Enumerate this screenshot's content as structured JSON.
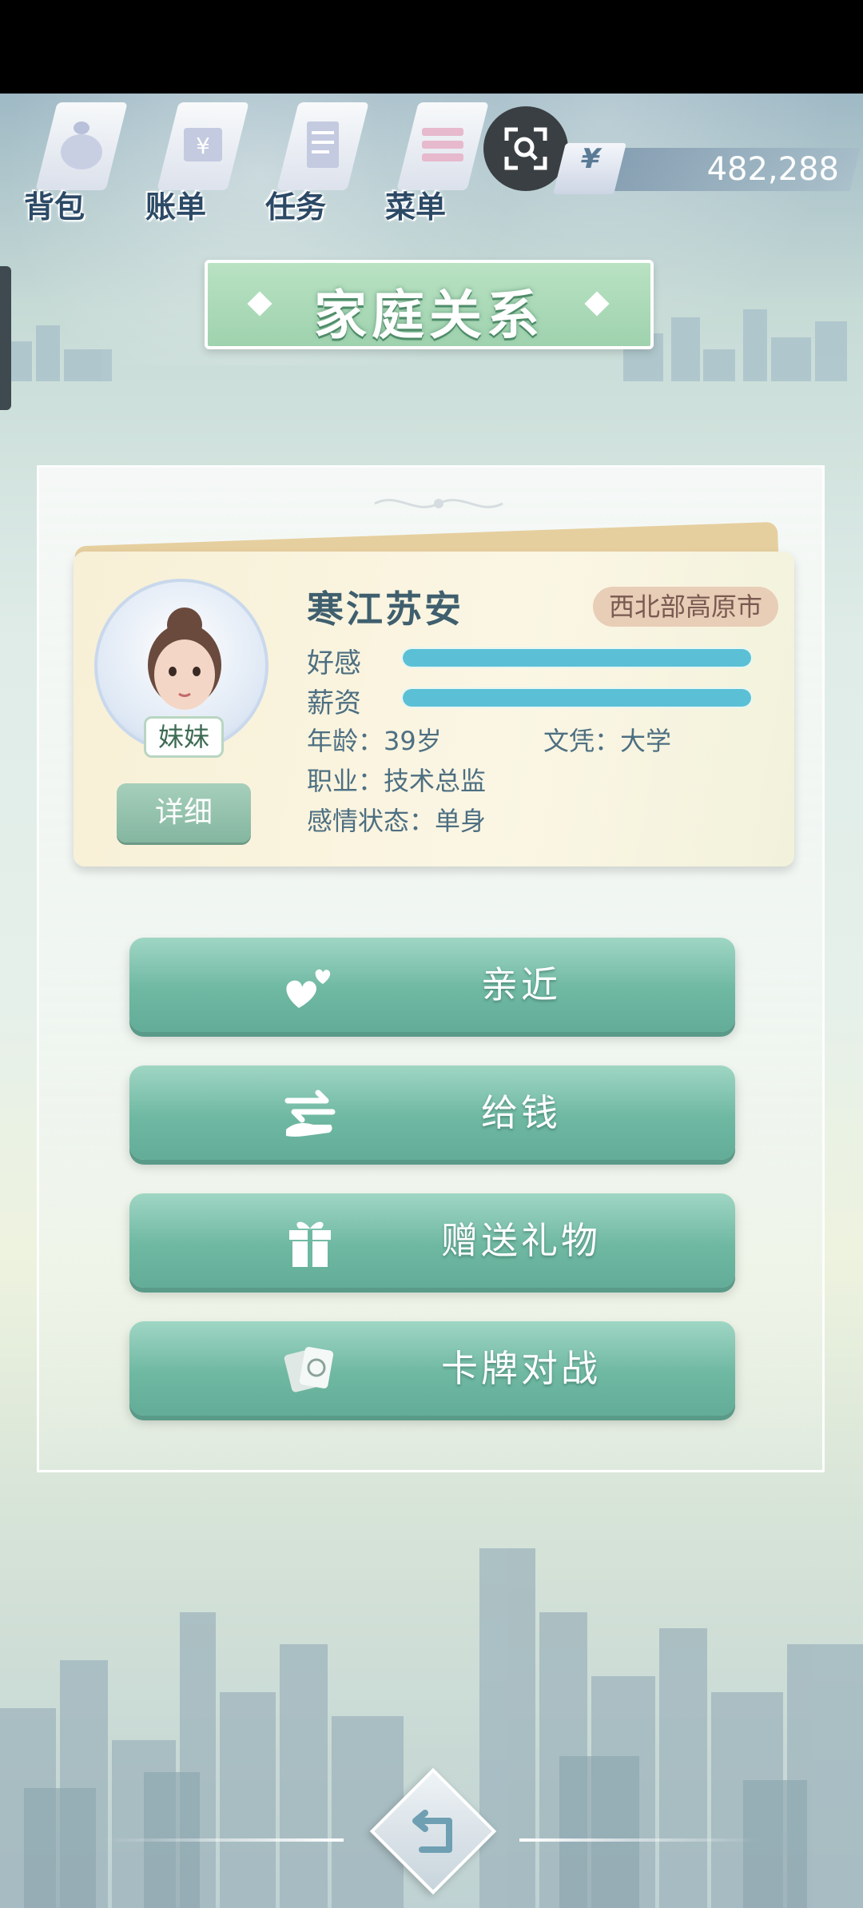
{
  "top_nav": {
    "items": [
      {
        "label": "背包",
        "icon": "bag-icon"
      },
      {
        "label": "账单",
        "icon": "bill-icon"
      },
      {
        "label": "任务",
        "icon": "task-icon"
      },
      {
        "label": "菜单",
        "icon": "menu-icon"
      }
    ]
  },
  "currency": {
    "symbol": "¥",
    "amount": "482,288"
  },
  "title": "家庭关系",
  "character": {
    "name": "寒江苏安",
    "region": "西北部高原市",
    "relation": "妹妹",
    "stats": [
      {
        "label": "好感",
        "value": 1.0
      },
      {
        "label": "薪资",
        "value": 1.0
      }
    ],
    "age": "年龄：39岁",
    "education": "文凭：大学",
    "occupation": "职业：技术总监",
    "relationship_status": "感情状态：单身",
    "detail_label": "详细"
  },
  "actions": [
    {
      "label": "亲近",
      "icon": "hearts-icon"
    },
    {
      "label": "给钱",
      "icon": "give-money-icon"
    },
    {
      "label": "赠送礼物",
      "icon": "gift-icon"
    },
    {
      "label": "卡牌对战",
      "icon": "cards-icon"
    }
  ],
  "colors": {
    "button_teal": "#6fb8a2",
    "stat_bar": "#5bc0d6",
    "title_green": "#9fd2ae",
    "region_tag": "#e8cdb7"
  }
}
